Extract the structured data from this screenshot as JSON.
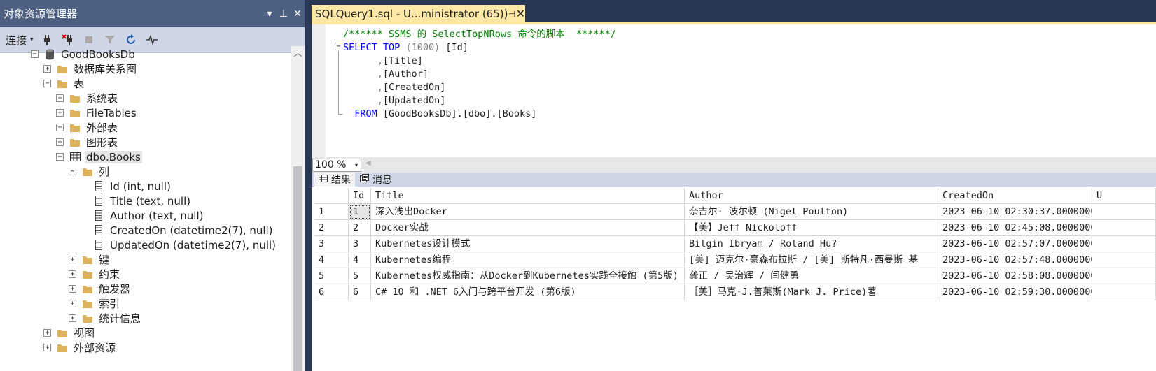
{
  "object_explorer": {
    "title": "对象资源管理器",
    "title_buttons": {
      "dropdown": "▾",
      "pin": "⊥",
      "close": "✕"
    },
    "toolbar": {
      "connect_label": "连接",
      "caret": "▾"
    },
    "tree": {
      "db": "GoodBooksDb",
      "db_diagrams": "数据库关系图",
      "tables": "表",
      "system_tables": "系统表",
      "file_tables": "FileTables",
      "external_tables": "外部表",
      "graph_tables": "图形表",
      "books_table": "dbo.Books",
      "columns_folder": "列",
      "columns": [
        "Id (int, null)",
        "Title (text, null)",
        "Author (text, null)",
        "CreatedOn (datetime2(7), null)",
        "UpdatedOn (datetime2(7), null)"
      ],
      "keys": "键",
      "constraints": "约束",
      "triggers": "触发器",
      "indexes": "索引",
      "statistics": "统计信息",
      "views": "视图",
      "external_resources": "外部资源"
    },
    "expander": {
      "plus": "+",
      "minus": "−"
    }
  },
  "document_tab": {
    "title": "SQLQuery1.sql - U...ministrator (65))",
    "pin": "⊣",
    "close": "✕"
  },
  "editor": {
    "line1": "/****** SSMS 的 SelectTopNRows 命令的脚本  ******/",
    "select_kw": "SELECT",
    "top_kw": "TOP",
    "top_count": "(1000)",
    "col_id": "[Id]",
    "comma": ",",
    "col_title": "[Title]",
    "col_author": "[Author]",
    "col_created": "[CreatedOn]",
    "col_updated": "[UpdatedOn]",
    "from_kw": "FROM",
    "from_table": "[GoodBooksDb].[dbo].[Books]"
  },
  "zoom": {
    "value": "100 %",
    "caret": "▾",
    "left_arrow": "◀"
  },
  "result_tabs": {
    "results": "结果",
    "messages": "消息"
  },
  "grid": {
    "columns": [
      "Id",
      "Title",
      "Author",
      "CreatedOn",
      "U"
    ],
    "rows": [
      {
        "num": "1",
        "id": "1",
        "title": "深入浅出Docker",
        "author": "奈吉尔· 波尔顿 (Nigel Poulton)",
        "created": "2023-06-10 02:30:37.0000000"
      },
      {
        "num": "2",
        "id": "2",
        "title": "Docker实战",
        "author": "【美】Jeff Nickoloff",
        "created": "2023-06-10 02:45:08.0000000"
      },
      {
        "num": "3",
        "id": "3",
        "title": "Kubernetes设计模式",
        "author": "Bilgin Ibryam / Roland Hu?",
        "created": "2023-06-10 02:57:07.0000000"
      },
      {
        "num": "4",
        "id": "4",
        "title": "Kubernetes编程",
        "author": "[美] 迈克尔·豪森布拉斯 / [美] 斯特凡·西曼斯 基",
        "created": "2023-06-10 02:57:48.0000000"
      },
      {
        "num": "5",
        "id": "5",
        "title": "Kubernetes权威指南：从Docker到Kubernetes实践全接触 (第5版)",
        "author": "龚正 / 吴治辉 / 闫健勇",
        "created": "2023-06-10 02:58:08.0000000"
      },
      {
        "num": "6",
        "id": "6",
        "title": "C# 10 和 .NET 6入门与跨平台开发 (第6版)",
        "author": "［美］马克·J.普莱斯(Mark J. Price)著",
        "created": "2023-06-10 02:59:30.0000000"
      }
    ]
  },
  "colors": {
    "title_bar": "#4d6082",
    "tab_active": "#ffe8a6",
    "keyword": "#0000ff",
    "comment": "#008000"
  }
}
